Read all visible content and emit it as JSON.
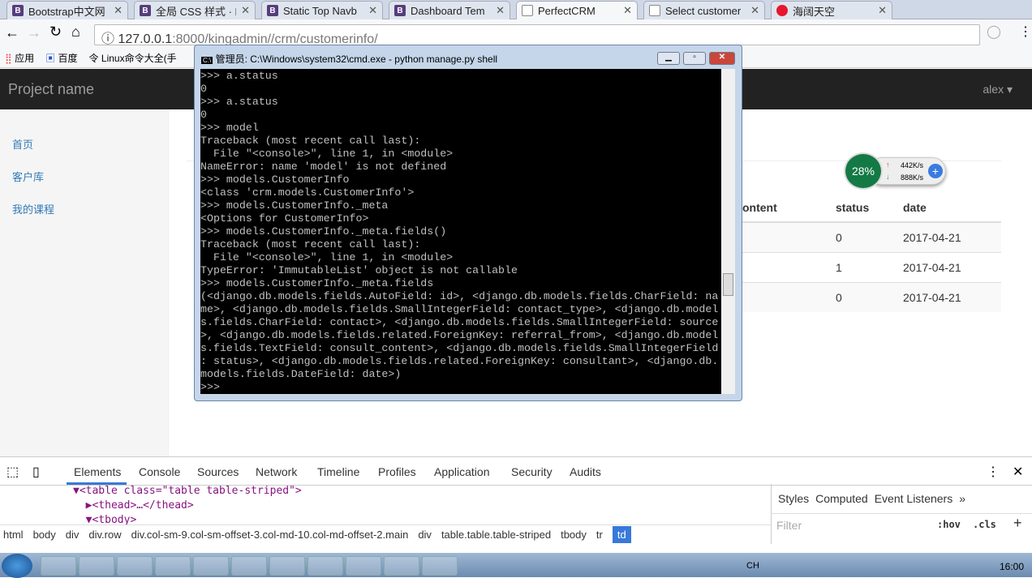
{
  "browser": {
    "tabs": [
      {
        "label": "Bootstrap中文网",
        "icon": "bootstrap-icon"
      },
      {
        "label": "全局 CSS 样式 · B",
        "icon": "bootstrap-icon"
      },
      {
        "label": "Static Top Navb",
        "icon": "bootstrap-icon"
      },
      {
        "label": "Dashboard Tem",
        "icon": "bootstrap-icon"
      },
      {
        "label": "PerfectCRM",
        "icon": "page-icon",
        "active": true
      },
      {
        "label": "Select customer",
        "icon": "page-icon"
      },
      {
        "label": "海阔天空",
        "icon": "weibo-icon"
      }
    ],
    "url_host": "127.0.0.1",
    "url_rest": ":8000/kingadmin//crm/customerinfo/",
    "bookmarks": [
      "应用",
      "百度",
      "Linux命令大全(手"
    ]
  },
  "app": {
    "brand": "Project name",
    "user": "alex ▾",
    "sidebar": [
      "首页",
      "客户库",
      "我的课程"
    ],
    "table": {
      "headers": [
        "ontent",
        "status",
        "date"
      ],
      "rows": [
        [
          "",
          "0",
          "2017-04-21"
        ],
        [
          "",
          "1",
          "2017-04-21"
        ],
        [
          "",
          "0",
          "2017-04-21"
        ]
      ]
    }
  },
  "speed_widget": {
    "percent": "28%",
    "up": "442K/s",
    "down": "888K/s"
  },
  "cmd": {
    "title": "管理员: C:\\Windows\\system32\\cmd.exe - python  manage.py shell",
    "output": ">>> a.status\n0\n>>> a.status\n0\n>>> model\nTraceback (most recent call last):\n  File \"<console>\", line 1, in <module>\nNameError: name 'model' is not defined\n>>> models.CustomerInfo\n<class 'crm.models.CustomerInfo'>\n>>> models.CustomerInfo._meta\n<Options for CustomerInfo>\n>>> models.CustomerInfo._meta.fields()\nTraceback (most recent call last):\n  File \"<console>\", line 1, in <module>\nTypeError: 'ImmutableList' object is not callable\n>>> models.CustomerInfo._meta.fields\n(<django.db.models.fields.AutoField: id>, <django.db.models.fields.CharField: na\nme>, <django.db.models.fields.SmallIntegerField: contact_type>, <django.db.model\ns.fields.CharField: contact>, <django.db.models.fields.SmallIntegerField: source\n>, <django.db.models.fields.related.ForeignKey: referral_from>, <django.db.model\ns.fields.TextField: consult_content>, <django.db.models.fields.SmallIntegerField\n: status>, <django.db.models.fields.related.ForeignKey: consultant>, <django.db.\nmodels.fields.DateField: date>)\n>>> "
  },
  "devtools": {
    "tabs": [
      "Elements",
      "Console",
      "Sources",
      "Network",
      "Timeline",
      "Profiles",
      "Application",
      "Security",
      "Audits"
    ],
    "code": [
      "▼<table class=\"table table-striped\">",
      "  ▶<thead>…</thead>",
      "  ▼<tbody>"
    ],
    "breadcrumbs": [
      "html",
      "body",
      "div",
      "div.row",
      "div.col-sm-9.col-sm-offset-3.col-md-10.col-md-offset-2.main",
      "div",
      "table.table.table-striped",
      "tbody",
      "tr",
      "td"
    ],
    "side_tabs": [
      "Styles",
      "Computed",
      "Event Listeners",
      "»"
    ],
    "filter_placeholder": "Filter",
    "hov": ":hov",
    "cls": ".cls"
  },
  "taskbar": {
    "clock": "16:00",
    "lang": "CH"
  }
}
